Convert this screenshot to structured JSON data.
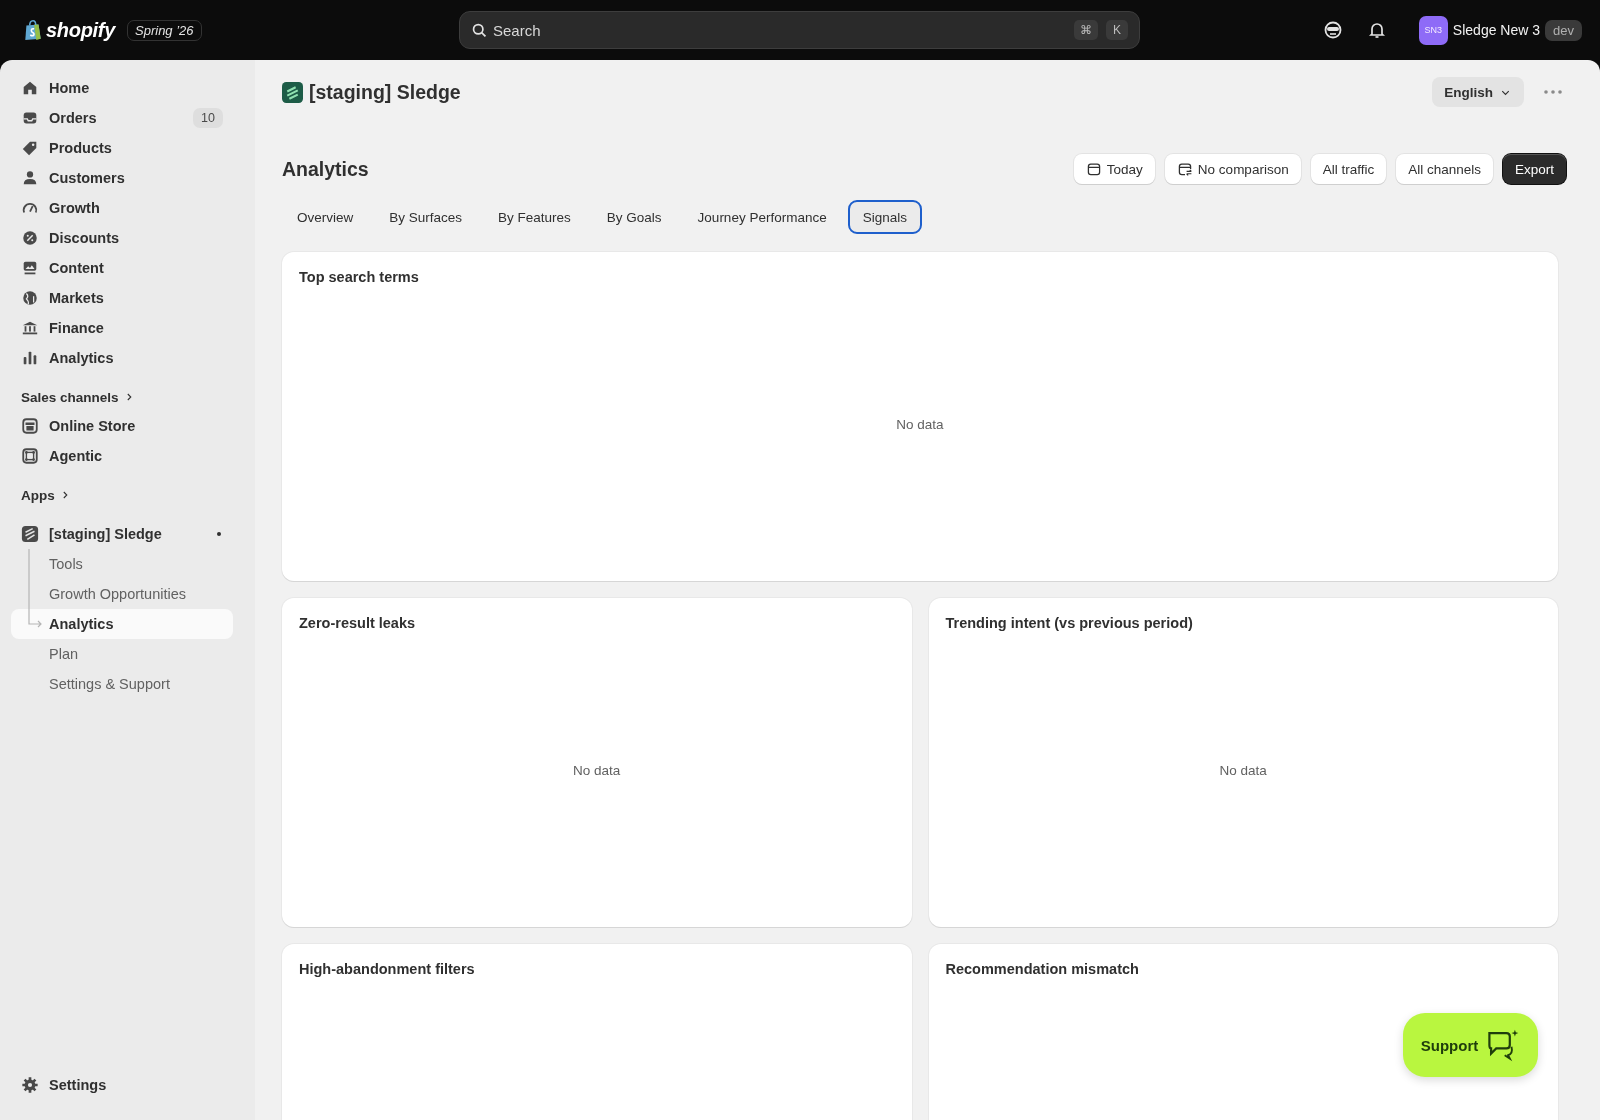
{
  "topbar": {
    "logo": "shopify",
    "edition": "Spring ’26",
    "search": {
      "placeholder": "Search",
      "shortcut": [
        "⌘",
        "K"
      ]
    },
    "store": {
      "initials": "SN3",
      "name": "Sledge New 3",
      "badge": "dev"
    }
  },
  "sidebar": {
    "items": [
      {
        "label": "Home"
      },
      {
        "label": "Orders",
        "badge": "10"
      },
      {
        "label": "Products"
      },
      {
        "label": "Customers"
      },
      {
        "label": "Growth"
      },
      {
        "label": "Discounts"
      },
      {
        "label": "Content"
      },
      {
        "label": "Markets"
      },
      {
        "label": "Finance"
      },
      {
        "label": "Analytics"
      }
    ],
    "sections": [
      {
        "title": "Sales channels",
        "items": [
          {
            "label": "Online Store"
          },
          {
            "label": "Agentic"
          }
        ]
      },
      {
        "title": "Apps"
      }
    ],
    "app": {
      "name": "[staging] Sledge",
      "children": [
        {
          "label": "Tools",
          "selected": false
        },
        {
          "label": "Growth Opportunities",
          "selected": false
        },
        {
          "label": "Analytics",
          "selected": true
        },
        {
          "label": "Plan",
          "selected": false
        },
        {
          "label": "Settings & Support",
          "selected": false
        }
      ]
    },
    "footer": {
      "label": "Settings"
    }
  },
  "page": {
    "app_title": "[staging] Sledge",
    "language": "English",
    "title": "Analytics",
    "actions": [
      {
        "label": "Today",
        "kind": "calendar"
      },
      {
        "label": "No comparison",
        "kind": "compare"
      },
      {
        "label": "All traffic",
        "kind": "plain"
      },
      {
        "label": "All channels",
        "kind": "plain"
      },
      {
        "label": "Export",
        "kind": "primary"
      }
    ],
    "tabs": [
      {
        "label": "Overview",
        "selected": false
      },
      {
        "label": "By Surfaces",
        "selected": false
      },
      {
        "label": "By Features",
        "selected": false
      },
      {
        "label": "By Goals",
        "selected": false
      },
      {
        "label": "Journey Performance",
        "selected": false
      },
      {
        "label": "Signals",
        "selected": true
      }
    ],
    "cards": [
      {
        "title": "Top search terms",
        "kind": "wide",
        "empty_text": "No data"
      },
      {
        "title": "Zero-result leaks",
        "kind": "half",
        "empty_text": "No data"
      },
      {
        "title": "Trending intent (vs previous period)",
        "kind": "half",
        "empty_text": "No data"
      },
      {
        "title": "High-abandonment filters",
        "kind": "half"
      },
      {
        "title": "Recommendation mismatch",
        "kind": "half"
      }
    ],
    "support": {
      "label": "Support"
    }
  }
}
